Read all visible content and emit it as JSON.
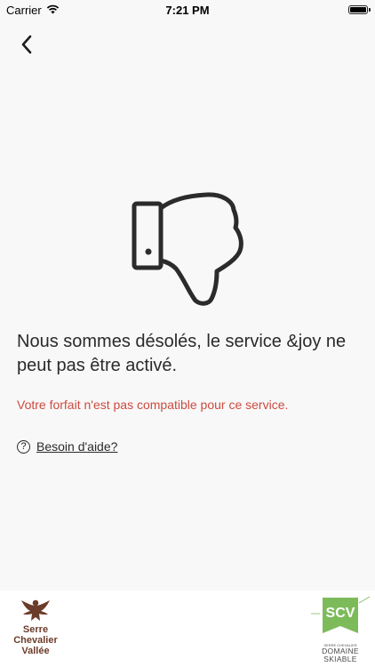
{
  "status_bar": {
    "carrier": "Carrier",
    "time": "7:21 PM"
  },
  "nav": {
    "back_icon": "chevron-left-icon"
  },
  "illustration": {
    "icon": "thumbs-down-icon"
  },
  "message": {
    "headline": "Nous sommes désolés, le service &joy ne peut pas être activé.",
    "error": "Votre forfait n'est pas compatible pour ce service.",
    "error_color": "#cc4b3f"
  },
  "help": {
    "icon": "question-circle-icon",
    "icon_glyph": "?",
    "label": "Besoin d'aide?"
  },
  "footer": {
    "left_logo": {
      "line1": "Serre",
      "line2": "Chevalier",
      "line3": "Vallée"
    },
    "right_logo": {
      "mark": "SCV",
      "small": "SERRE CHEVALIER",
      "line1": "DOMAINE",
      "line2": "SKIABLE"
    },
    "brand_green": "#7dbb5a",
    "brand_brown": "#6b3c2b"
  }
}
